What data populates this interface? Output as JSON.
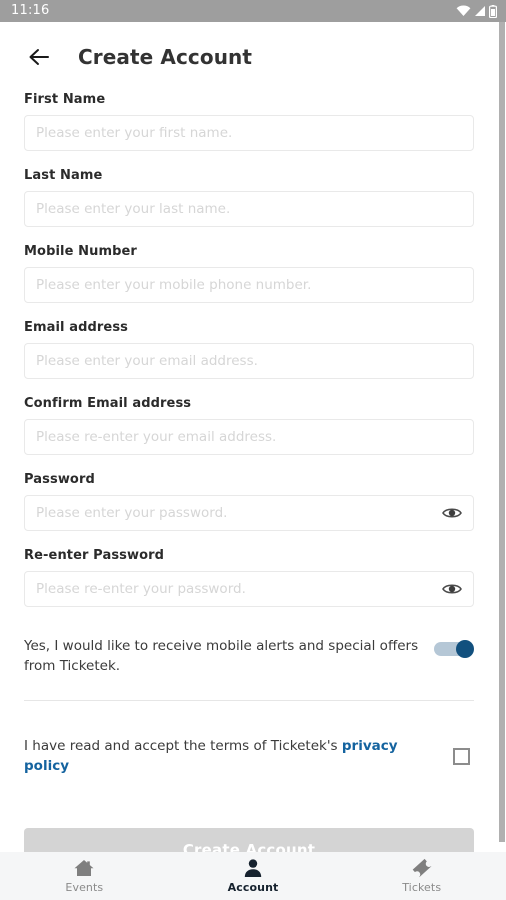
{
  "status_bar": {
    "time": "11:16",
    "icons": [
      "wifi-icon",
      "signal-icon",
      "battery-icon"
    ]
  },
  "header": {
    "back_icon": "back-arrow-icon",
    "title": "Create Account"
  },
  "form": {
    "fields": [
      {
        "label": "First Name",
        "placeholder": "Please enter your first name.",
        "type": "text",
        "name": "first-name",
        "has_eye": false
      },
      {
        "label": "Last Name",
        "placeholder": "Please enter your last name.",
        "type": "text",
        "name": "last-name",
        "has_eye": false
      },
      {
        "label": "Mobile Number",
        "placeholder": "Please enter your mobile phone number.",
        "type": "tel",
        "name": "mobile-number",
        "has_eye": false
      },
      {
        "label": "Email address",
        "placeholder": "Please enter your email address.",
        "type": "email",
        "name": "email-address",
        "has_eye": false
      },
      {
        "label": "Confirm Email address",
        "placeholder": "Please re-enter your email address.",
        "type": "email",
        "name": "confirm-email-address",
        "has_eye": false
      },
      {
        "label": "Password",
        "placeholder": "Please enter your password.",
        "type": "password",
        "name": "password",
        "has_eye": true
      },
      {
        "label": "Re-enter Password",
        "placeholder": "Please re-enter your password.",
        "type": "password",
        "name": "reenter-password",
        "has_eye": true
      }
    ],
    "optin": {
      "text": "Yes, I would like to receive mobile alerts and special offers from Ticketek.",
      "toggle_on": true,
      "toggle_on_color": "#12507e",
      "toggle_track_color": "#b5c7d6"
    },
    "privacy": {
      "text_before": "I have read and accept the terms of Ticketek's ",
      "link_text": "privacy policy",
      "link_color": "#14639f",
      "checked": false
    },
    "submit": {
      "label": "Create Account",
      "enabled": false,
      "background": "#d4d4d4",
      "text_color": "#ffffff"
    }
  },
  "bottom_nav": {
    "items": [
      {
        "label": "Events",
        "icon": "home-icon",
        "active": false
      },
      {
        "label": "Account",
        "icon": "person-icon",
        "active": true
      },
      {
        "label": "Tickets",
        "icon": "ticket-icon",
        "active": false
      }
    ],
    "active_color": "#16222e",
    "inactive_color": "#8a8a8a"
  }
}
